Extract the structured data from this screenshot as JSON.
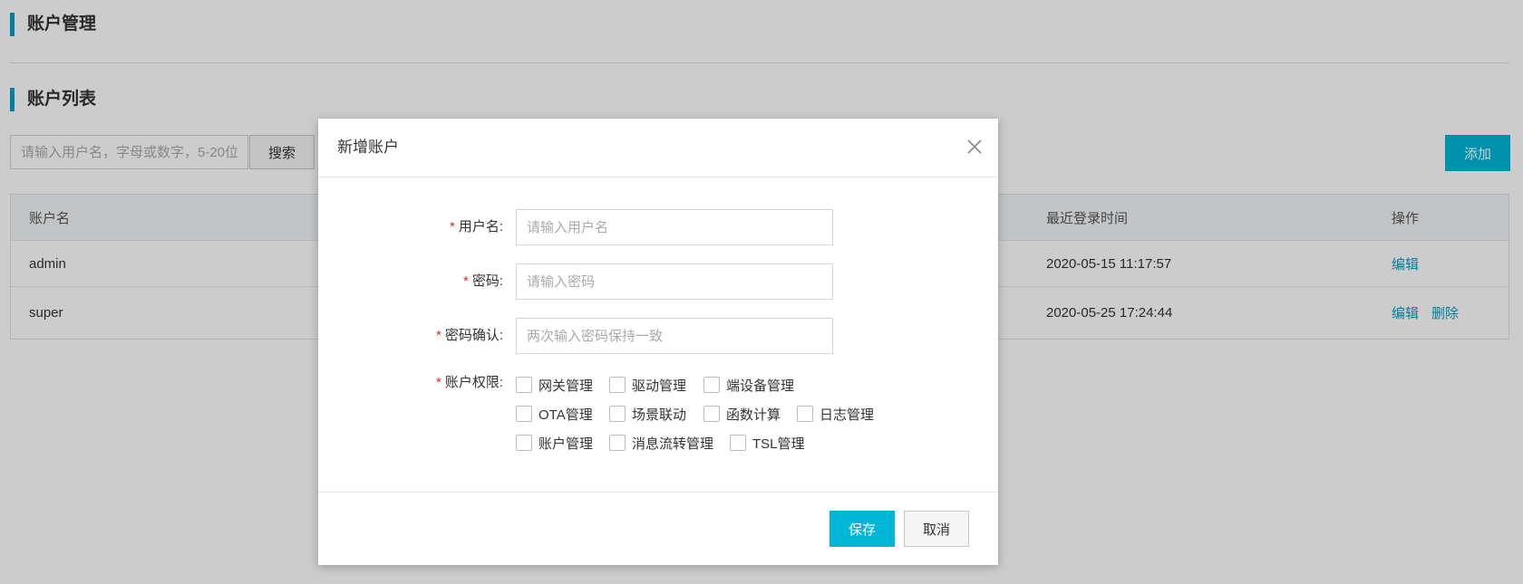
{
  "page": {
    "title": "账户管理",
    "list_title": "账户列表",
    "search_placeholder": "请输入用户名，字母或数字，5-20位",
    "search_label": "搜索",
    "add_label": "添加"
  },
  "table": {
    "headers": {
      "name": "账户名",
      "last_login": "最近登录时间",
      "actions": "操作"
    },
    "rows": [
      {
        "name": "admin",
        "last_login": "2020-05-15 11:17:57",
        "actions": [
          "编辑"
        ]
      },
      {
        "name": "super",
        "last_login": "2020-05-25 17:24:44",
        "actions": [
          "编辑",
          "删除"
        ]
      }
    ]
  },
  "modal": {
    "title": "新增账户",
    "required_mark": "*",
    "fields": {
      "username": {
        "label": "用户名:",
        "placeholder": "请输入用户名"
      },
      "password": {
        "label": "密码:",
        "placeholder": "请输入密码"
      },
      "password_confirm": {
        "label": "密码确认:",
        "placeholder": "两次输入密码保持一致"
      }
    },
    "permissions_label": "账户权限:",
    "permissions": [
      "网关管理",
      "驱动管理",
      "端设备管理",
      "OTA管理",
      "场景联动",
      "函数计算",
      "日志管理",
      "账户管理",
      "消息流转管理",
      "TSL管理"
    ],
    "save_label": "保存",
    "cancel_label": "取消"
  },
  "colors": {
    "accent": "#00b7d8",
    "link": "#00a2c7",
    "required": "#e0281f"
  }
}
